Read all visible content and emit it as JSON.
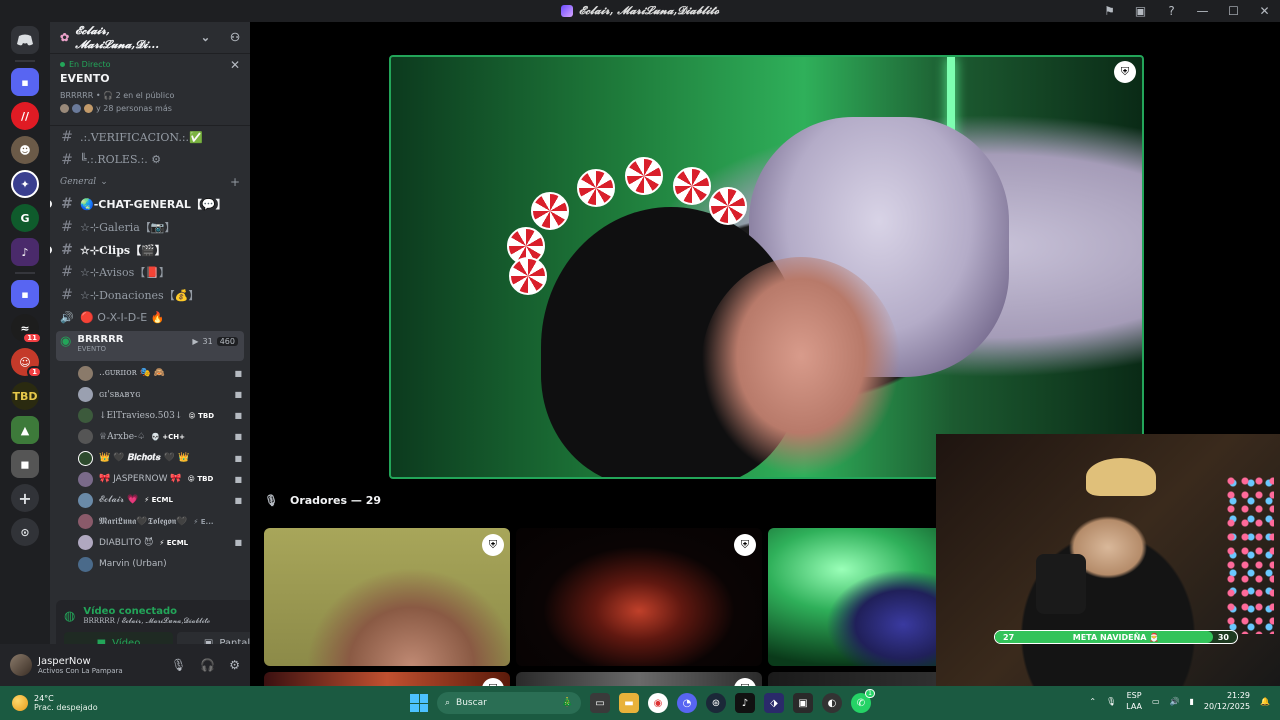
{
  "window": {
    "title": "𝓔𝓬𝓵𝓪𝓲𝓻, 𝓜𝓪𝓻𝓲𝓛𝓾𝓷𝓪,𝓓𝓲𝓪𝓫𝓵𝓲𝓽𝓸"
  },
  "server": {
    "name": "𝓔𝓬𝓵𝓪𝓲𝓻, 𝓜𝓪𝓻𝓲𝓛𝓾𝓷𝓪,𝓓𝓲..."
  },
  "server_badges": [
    "11",
    "1"
  ],
  "event": {
    "live_label": "En Directo",
    "title": "EVENTO",
    "meta": "BRRRRR • 🎧 2 en el público",
    "audience": "y 28 personas más"
  },
  "top_channels": [
    {
      "name": ".:.VERIFICACION.:.✅"
    },
    {
      "name": "╚.:.ROLES.:. ⚙"
    }
  ],
  "category": {
    "name": "General"
  },
  "channels": [
    {
      "name": "🌏-CHAT-GENERAL【💬】",
      "bold": true,
      "icon": "#"
    },
    {
      "name": "☆⊹Galeria【📷】",
      "bold": false,
      "icon": "#"
    },
    {
      "name": "☆⊹Clips【🎬】",
      "bold": true,
      "icon": "#"
    },
    {
      "name": "☆⊹Avisos【📕】",
      "bold": false,
      "icon": "#"
    },
    {
      "name": "☆⊹Donaciones【💰】",
      "bold": false,
      "icon": "#"
    },
    {
      "name": "🔴 O-X-I-D-E 🔥",
      "bold": false,
      "icon": "🔊"
    }
  ],
  "voice_channel": {
    "name": "BRRRRR",
    "sub": "EVENTO",
    "cams": "31",
    "listeners": "460"
  },
  "members": [
    {
      "name": "..ɢᴜʀɪɪᴏʀ 🎭 🙈",
      "tag": ""
    },
    {
      "name": "ɢɪ'sʙᴀʙʏɢ",
      "tag": ""
    },
    {
      "name": "↓ElTravieso.503↓",
      "tag": "😝 TBD"
    },
    {
      "name": "♕Arxbe-♤",
      "tag": "💀 +CH+"
    },
    {
      "name": "👑 🖤 𝑩𝒊𝒄𝒉𝒐𝒕𝒔 🖤 👑",
      "tag": ""
    },
    {
      "name": "🎀 JASPERNOW 🎀",
      "tag": "😝 TBD"
    },
    {
      "name": "𝓔𝓬𝓵𝓪𝓲𝓻 💗",
      "tag": "⚡ ECML"
    },
    {
      "name": "𝕸𝖆𝖗𝖎𝕷𝖚𝖓𝖆🖤𝕿𝖔𝖑𝖊𝖌𝖔𝖓🖤",
      "tag": "⚡ E..."
    },
    {
      "name": "DIABLITO 😈",
      "tag": "⚡ ECML"
    },
    {
      "name": "Marvin (Urban)",
      "tag": ""
    }
  ],
  "voice_connected": {
    "status": "Vídeo conectado",
    "location": "BRRRRR / 𝓔𝓬𝓵𝓪𝓲𝓻, 𝓜𝓪𝓻𝓲𝓛𝓾𝓷𝓪,𝓓𝓲𝓪𝓫𝓵𝓲𝓽𝓸",
    "video_label": "Vídeo",
    "screen_label": "Pantalla"
  },
  "user": {
    "name": "JasperNow",
    "status": "Activos Con La Pampara"
  },
  "stage": {
    "speakers_label": "Oradores — 29"
  },
  "goal": {
    "label": "META NAVIDEÑA 🎅",
    "current": "27",
    "target": "30",
    "progress": 0.9
  },
  "taskbar": {
    "weather_temp": "24°C",
    "weather_desc": "Prac. despejado",
    "search_placeholder": "Buscar",
    "lang_line1": "ESP",
    "lang_line2": "LAA",
    "time": "21:29",
    "date": "20/12/2025",
    "whatsapp_badge": "1"
  },
  "colors": {
    "green": "#23a559",
    "taskbar": "#1b5a41",
    "sidebar": "#2b2d31"
  }
}
